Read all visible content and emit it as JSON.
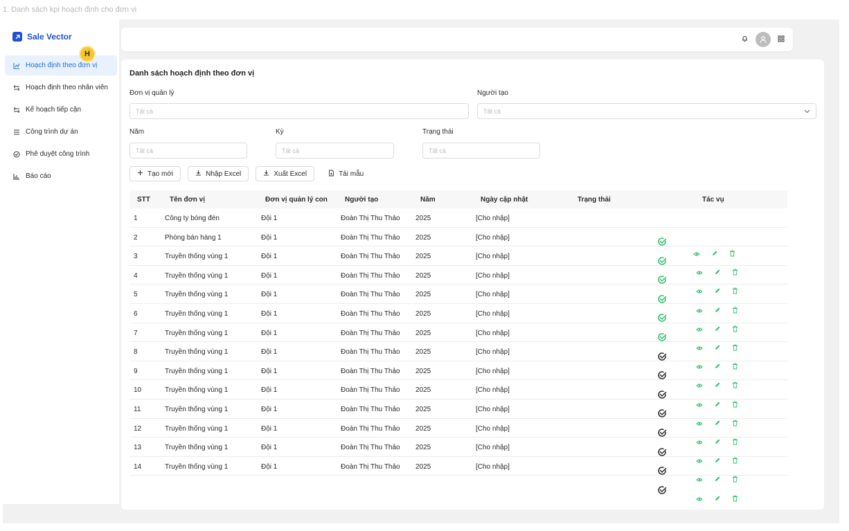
{
  "frame_title": "1. Danh sách kpi hoạch định cho đơn vị",
  "brand": {
    "name": "Sale Vector",
    "logo_icon": "arrow-up-right-icon",
    "color": "#1d4fd8"
  },
  "avatar_badge": "H",
  "sidebar": {
    "items": [
      {
        "label": "Hoạch định theo đơn vị",
        "icon": "line-chart-icon",
        "active": true
      },
      {
        "label": "Hoạch định theo nhân viên",
        "icon": "arrows-icon",
        "active": false
      },
      {
        "label": "Kế hoạch tiếp cận",
        "icon": "arrows-icon",
        "active": false
      },
      {
        "label": "Công trình dự án",
        "icon": "list-icon",
        "active": false
      },
      {
        "label": "Phê duyệt công trình",
        "icon": "check-circle-icon",
        "active": false
      },
      {
        "label": "Báo cáo",
        "icon": "bar-chart-icon",
        "active": false
      }
    ]
  },
  "topbar": {
    "icons": [
      "bell-icon",
      "user-avatar-icon",
      "grid-icon"
    ]
  },
  "page": {
    "title": "Danh sách hoạch định theo đơn vị",
    "filters": {
      "don_vi_label": "Đơn vị quản lý",
      "don_vi_placeholder": "Tất cả",
      "nguoi_tao_label": "Người tạo",
      "nguoi_tao_placeholder": "Tất cả",
      "nam_label": "Năm",
      "nam_placeholder": "Tất cả",
      "ky_label": "Kỳ",
      "ky_placeholder": "Tất cả",
      "trang_thai_label": "Trạng thái",
      "trang_thai_placeholder": "Tất cả"
    },
    "toolbar": {
      "create": "Tạo mới",
      "import": "Nhập Excel",
      "export": "Xuất Excel",
      "template": "Tải mẫu"
    }
  },
  "table": {
    "headers": {
      "stt": "STT",
      "ten": "Tên đơn vị",
      "dvql": "Đơn vị quản lý con",
      "nguoi": "Người tạo",
      "nam": "Năm",
      "ngay": "Ngày cập nhật",
      "tt": "Trạng thái",
      "tacvu": "Tác vụ"
    },
    "rows": [
      {
        "stt": "1",
        "ten": "Công ty bóng đèn",
        "dvql": "Đội 1",
        "nguoi": "Đoàn Thị Thu Thảo",
        "nam": "2025",
        "ngay": "[Cho nhập]"
      },
      {
        "stt": "2",
        "ten": "Phòng bán hàng 1",
        "dvql": "Đội 1",
        "nguoi": "Đoàn Thị Thu Thảo",
        "nam": "2025",
        "ngay": "[Cho nhập]"
      },
      {
        "stt": "3",
        "ten": "Truyền thống vùng 1",
        "dvql": "Đội 1",
        "nguoi": "Đoàn Thị Thu Thảo",
        "nam": "2025",
        "ngay": "[Cho nhập]"
      },
      {
        "stt": "4",
        "ten": "Truyền thống vùng 1",
        "dvql": "Đội 1",
        "nguoi": "Đoàn Thị Thu Thảo",
        "nam": "2025",
        "ngay": "[Cho nhập]"
      },
      {
        "stt": "5",
        "ten": "Truyền thống vùng 1",
        "dvql": "Đội 1",
        "nguoi": "Đoàn Thị Thu Thảo",
        "nam": "2025",
        "ngay": "[Cho nhập]"
      },
      {
        "stt": "6",
        "ten": "Truyền thống vùng 1",
        "dvql": "Đội 1",
        "nguoi": "Đoàn Thị Thu Thảo",
        "nam": "2025",
        "ngay": "[Cho nhập]"
      },
      {
        "stt": "7",
        "ten": "Truyền thống vùng 1",
        "dvql": "Đội 1",
        "nguoi": "Đoàn Thị Thu Thảo",
        "nam": "2025",
        "ngay": "[Cho nhập]"
      },
      {
        "stt": "8",
        "ten": "Truyền thống vùng 1",
        "dvql": "Đội 1",
        "nguoi": "Đoàn Thị Thu Thảo",
        "nam": "2025",
        "ngay": "[Cho nhập]"
      },
      {
        "stt": "9",
        "ten": "Truyền thống vùng 1",
        "dvql": "Đội 1",
        "nguoi": "Đoàn Thị Thu Thảo",
        "nam": "2025",
        "ngay": "[Cho nhập]"
      },
      {
        "stt": "10",
        "ten": "Truyền thống vùng 1",
        "dvql": "Đội 1",
        "nguoi": "Đoàn Thị Thu Thảo",
        "nam": "2025",
        "ngay": "[Cho nhập]"
      },
      {
        "stt": "11",
        "ten": "Truyền thống vùng 1",
        "dvql": "Đội 1",
        "nguoi": "Đoàn Thị Thu Thảo",
        "nam": "2025",
        "ngay": "[Cho nhập]"
      },
      {
        "stt": "12",
        "ten": "Truyền thống vùng 1",
        "dvql": "Đội 1",
        "nguoi": "Đoàn Thị Thu Thảo",
        "nam": "2025",
        "ngay": "[Cho nhập]"
      },
      {
        "stt": "13",
        "ten": "Truyền thống vùng 1",
        "dvql": "Đội 1",
        "nguoi": "Đoàn Thị Thu Thảo",
        "nam": "2025",
        "ngay": "[Cho nhập]"
      },
      {
        "stt": "14",
        "ten": "Truyền thống vùng 1",
        "dvql": "Đội 1",
        "nguoi": "Đoàn Thị Thu Thảo",
        "nam": "2025",
        "ngay": "[Cho nhập]"
      }
    ],
    "status_icons": [
      "check-circle-green",
      "check-circle-green",
      "check-circle-green",
      "check-circle-green",
      "check-circle-green",
      "check-circle-green",
      "check-circle-dark",
      "check-circle-dark",
      "check-circle-dark",
      "check-circle-dark",
      "check-circle-dark",
      "check-circle-dark",
      "check-circle-dark",
      "check-circle-dark"
    ],
    "action_icons": [
      "eye-icon",
      "pencil-icon",
      "trash-icon"
    ],
    "colors": {
      "green": "#2ebd6b",
      "dark": "#2a2a2a",
      "active_bg": "#e8f1fd",
      "active_text": "#1d6fd8"
    }
  }
}
